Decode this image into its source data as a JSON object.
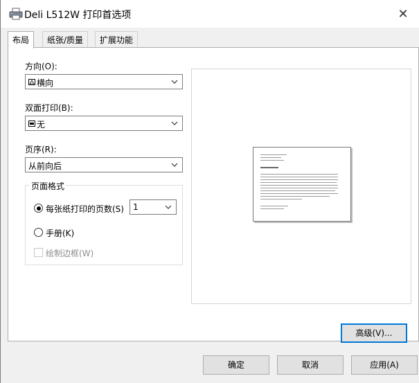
{
  "window": {
    "title": "Deli L512W 打印首选项",
    "close_symbol": "✕"
  },
  "tabs": [
    {
      "label": "布局",
      "active": true
    },
    {
      "label": "纸张/质量",
      "active": false
    },
    {
      "label": "扩展功能",
      "active": false
    }
  ],
  "layout": {
    "orientation": {
      "label": "方向(O):",
      "value": "横向",
      "icon": "landscape-page-icon"
    },
    "duplex": {
      "label": "双面打印(B):",
      "value": "无",
      "icon": "duplex-none-icon"
    },
    "page_order": {
      "label": "页序(R):",
      "value": "从前向后"
    },
    "page_format": {
      "title": "页面格式",
      "pages_per_sheet": {
        "label": "每张纸打印的页数(S)",
        "value": "1",
        "checked": true
      },
      "booklet": {
        "label": "手册(K)",
        "checked": false
      },
      "draw_borders": {
        "label": "绘制边框(W)",
        "checked": false,
        "disabled": true
      }
    },
    "advanced_button": "高级(V)..."
  },
  "footer": {
    "ok": "确定",
    "cancel": "取消",
    "apply": "应用(A)"
  },
  "colors": {
    "accent": "#0078d7",
    "panel": "#ffffff",
    "window_bg": "#f0f0f0"
  }
}
